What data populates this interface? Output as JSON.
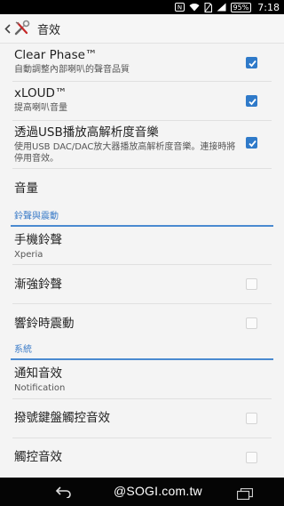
{
  "status_bar": {
    "battery": "95%",
    "time": "7:18",
    "icons": [
      "nfc-icon",
      "wifi-icon",
      "no-sim-icon",
      "signal-icon",
      "battery-icon"
    ]
  },
  "action_bar": {
    "title": "音效",
    "icons": [
      "back-chevron-icon",
      "sound-settings-app-icon"
    ]
  },
  "settings": {
    "clear_phase": {
      "title": "Clear Phase™",
      "summary": "自動調整內部喇叭的聲音品質",
      "checked": true
    },
    "xloud": {
      "title": "xLOUD™",
      "summary": "提高喇叭音量",
      "checked": true
    },
    "usb_audio": {
      "title": "透過USB播放高解析度音樂",
      "summary": "使用USB DAC/DAC放大器播放高解析度音樂。連接時將停用音效。",
      "checked": true
    },
    "volume": {
      "title": "音量"
    },
    "ringtone_section": {
      "label": "鈴聲與震動"
    },
    "phone_ringtone": {
      "title": "手機鈴聲",
      "summary": "Xperia"
    },
    "ascending_ringtone": {
      "title": "漸強鈴聲",
      "checked": false
    },
    "vibrate_on_ring": {
      "title": "響鈴時震動",
      "checked": false
    },
    "system_section": {
      "label": "系統"
    },
    "notification_sound": {
      "title": "通知音效",
      "summary": "Notification"
    },
    "dial_pad_tones": {
      "title": "撥號鍵盤觸控音效",
      "checked": false
    },
    "touch_sounds": {
      "title": "觸控音效",
      "checked": false
    }
  },
  "nav_bar": {
    "watermark": "@SOGI.com.tw",
    "icons": [
      "back-icon",
      "recent-apps-icon"
    ]
  },
  "colors": {
    "accent": "#2f7ac9",
    "section_text": "#3a7bc8",
    "background": "#f4f4f4"
  }
}
